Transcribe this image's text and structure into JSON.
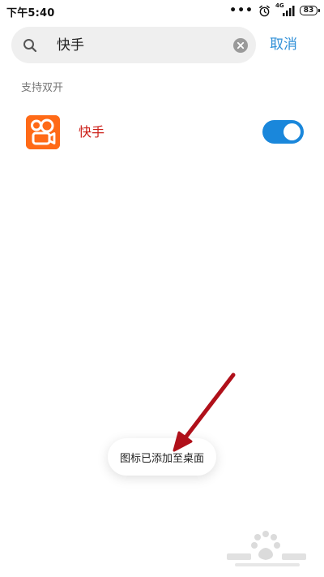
{
  "status_bar": {
    "time": "下午5:40",
    "network_label": "4G",
    "battery_level": "83",
    "icons": [
      "more-dots-icon",
      "alarm-clock-icon",
      "signal-icon",
      "battery-icon"
    ]
  },
  "search": {
    "query": "快手",
    "cancel_label": "取消",
    "icons": [
      "search-icon",
      "clear-icon"
    ]
  },
  "section": {
    "label": "支持双开"
  },
  "apps": [
    {
      "name": "快手",
      "icon": "kuaishou-app-icon",
      "dual_enabled": true
    }
  ],
  "toast": {
    "message": "图标已添加至桌面"
  },
  "colors": {
    "accent": "#2f8fd7",
    "toggle_on": "#1a87db",
    "app_name_red": "#cc1f18",
    "app_icon_orange": "#ff6a17",
    "annotation_red": "#b0101a"
  }
}
